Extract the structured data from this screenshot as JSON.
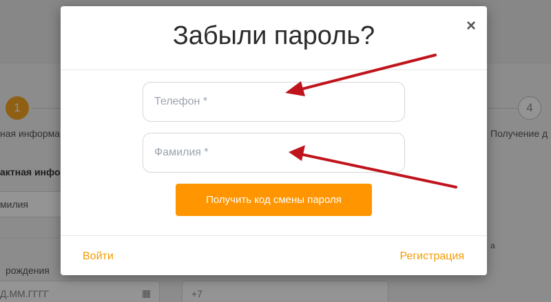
{
  "background": {
    "step1_number": "1",
    "step4_number": "4",
    "step1_label": "ная информа",
    "step4_label": "Получение д",
    "contact_section": "актная инфо",
    "surname_field": "милия",
    "birthdate_label": "рождения",
    "date_placeholder": "Д.ММ.ГГГГ",
    "phone_prefix": "+7",
    "right_fragment": "а"
  },
  "modal": {
    "title": "Забыли пароль?",
    "close_symbol": "×",
    "phone_placeholder": "Телефон *",
    "surname_placeholder": "Фамилия *",
    "submit_label": "Получить код смены пароля",
    "login_link": "Войти",
    "register_link": "Регистрация"
  },
  "colors": {
    "accent": "#ff9500",
    "link": "#f39c00",
    "annotation_arrow": "#c0141c"
  }
}
